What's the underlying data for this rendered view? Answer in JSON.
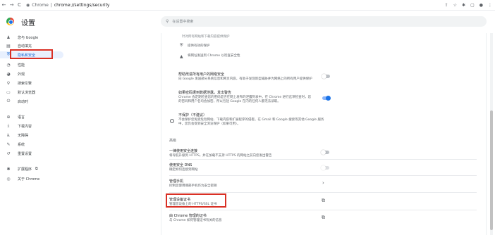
{
  "browser": {
    "site_label": "Chrome",
    "url_path": "chrome://settings/security",
    "back": "←",
    "forward": "→",
    "reload": "C"
  },
  "app": {
    "title": "设置"
  },
  "search": {
    "placeholder": "在设置中搜索"
  },
  "sidebar": {
    "items": [
      {
        "label": "您与 Google",
        "icon": "person-icon"
      },
      {
        "label": "自动填充",
        "icon": "clipboard-icon"
      },
      {
        "label": "隐私和安全",
        "icon": "shield-icon"
      },
      {
        "label": "性能",
        "icon": "speed-icon"
      },
      {
        "label": "外观",
        "icon": "palette-icon"
      },
      {
        "label": "搜索引擎",
        "icon": "search-icon"
      },
      {
        "label": "默认浏览器",
        "icon": "browser-icon"
      },
      {
        "label": "启动时",
        "icon": "power-icon"
      },
      {
        "label": "语言",
        "icon": "globe-icon"
      },
      {
        "label": "下载内容",
        "icon": "download-icon"
      },
      {
        "label": "无障碍",
        "icon": "accessibility-icon"
      },
      {
        "label": "系统",
        "icon": "wrench-icon"
      },
      {
        "label": "重置设置",
        "icon": "reset-icon"
      },
      {
        "label": "扩展程序",
        "icon": "puzzle-icon"
      },
      {
        "label": "关于 Chrome",
        "icon": "chrome-icon"
      }
    ]
  },
  "main": {
    "top_cut_text": "针对所有网站和下载内容提供保护",
    "bullet1": "提供有效的保护",
    "bullet2": "将网址发送到 Chrome 以检查安全性",
    "item_warn_title": "帮助改进所有用户的网络安全",
    "item_warn_desc": "向 Google 发送部分系统信息和网页内容，有助于发现新型威胁并为网络上的所有用户提供保护",
    "item_leak_title": "如果密码遭到数据泄露，发出警告",
    "item_leak_desc": "Chrome 会定期检查您的密码是否在网上发布的泄露列表中。在 Chrome 进行这项检查时，您的密码和用户名均会加密，所以包括 Google 在内的任何人都无法读取。",
    "no_protection_title": "不保护（不建议）",
    "no_protection_desc": "不会保护您免受危险网站、下载内容和扩展程序的侵害。在 Gmail 和 Google 搜索等其他 Google 服务中，您仍会受到安全浏览保护（如果可用）。",
    "advanced_head": "高级",
    "https_title": "一律使用安全连接",
    "https_desc": "将导航升级到 HTTPS，并在加载不支持 HTTPS 的网站之前向您发出警告",
    "dns_title": "使用安全 DNS",
    "dns_desc": "确定如何连接到网站",
    "phone_title": "管理手机",
    "phone_desc": "控制您使用哪部手机作为安全密钥",
    "cert_title": "管理设备证书",
    "cert_desc": "管理您设备上的 HTTPS/SSL 证书",
    "chrome_cert_title": "由 Chrome 管理的证书",
    "chrome_cert_desc": "与 Chrome 如何管理证书有关的信息"
  },
  "colors": {
    "accent": "#1a73e8",
    "highlight": "#d93025"
  }
}
